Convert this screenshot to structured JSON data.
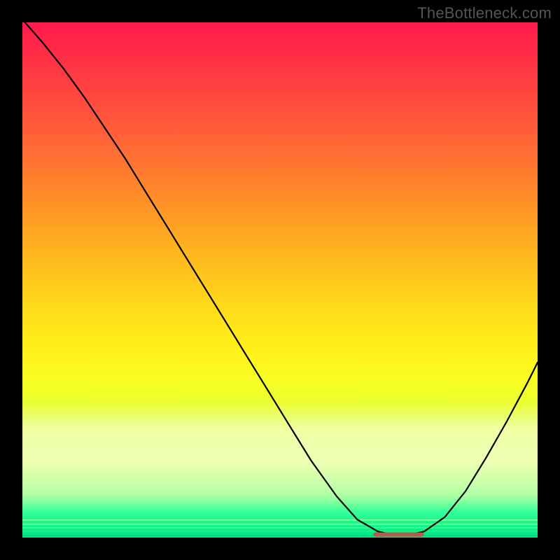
{
  "watermark": "TheBottleneck.com",
  "chart_data": {
    "type": "line",
    "title": "",
    "xlabel": "",
    "ylabel": "",
    "xlim": [
      0,
      100
    ],
    "ylim": [
      0,
      100
    ],
    "grid": false,
    "legend": false,
    "background": {
      "direction": "vertical",
      "stops": [
        {
          "pos": 0.0,
          "color": "#ff1a4d"
        },
        {
          "pos": 0.2,
          "color": "#ff5a3a"
        },
        {
          "pos": 0.45,
          "color": "#ffb71f"
        },
        {
          "pos": 0.64,
          "color": "#fff21a"
        },
        {
          "pos": 0.82,
          "color": "#ccff4d"
        },
        {
          "pos": 1.0,
          "color": "#00e58a"
        }
      ],
      "pale_band_y": [
        73.5,
        95
      ],
      "bottom_stripes_y": [
        96.5,
        97.3,
        98.0,
        98.6,
        99.1,
        99.5
      ]
    },
    "series": [
      {
        "name": "bottleneck-curve",
        "color": "#000000",
        "x": [
          0.5,
          4,
          8,
          12,
          16,
          20,
          24,
          28,
          32,
          36,
          40,
          44,
          48,
          52,
          56,
          61,
          65,
          69,
          72,
          75,
          78,
          82,
          86,
          90,
          94,
          98,
          100
        ],
        "y": [
          100,
          96,
          91,
          85.5,
          79.5,
          73.5,
          67,
          60.5,
          54,
          47.5,
          41,
          34.5,
          28,
          21.5,
          15,
          8,
          3.5,
          1.2,
          0.5,
          0.5,
          1.2,
          4,
          9,
          15.5,
          22.5,
          30,
          34
        ]
      },
      {
        "name": "optimal-flat-segment",
        "color": "#c06050",
        "x": [
          68.5,
          77.5
        ],
        "y": [
          0.6,
          0.6
        ]
      }
    ],
    "notes": "y expressed as percentage of plot height from bottom; valley minimum around x≈72–75 at y≈0.5; left branch starts at top-left corner; right branch exits right edge around y≈34."
  }
}
